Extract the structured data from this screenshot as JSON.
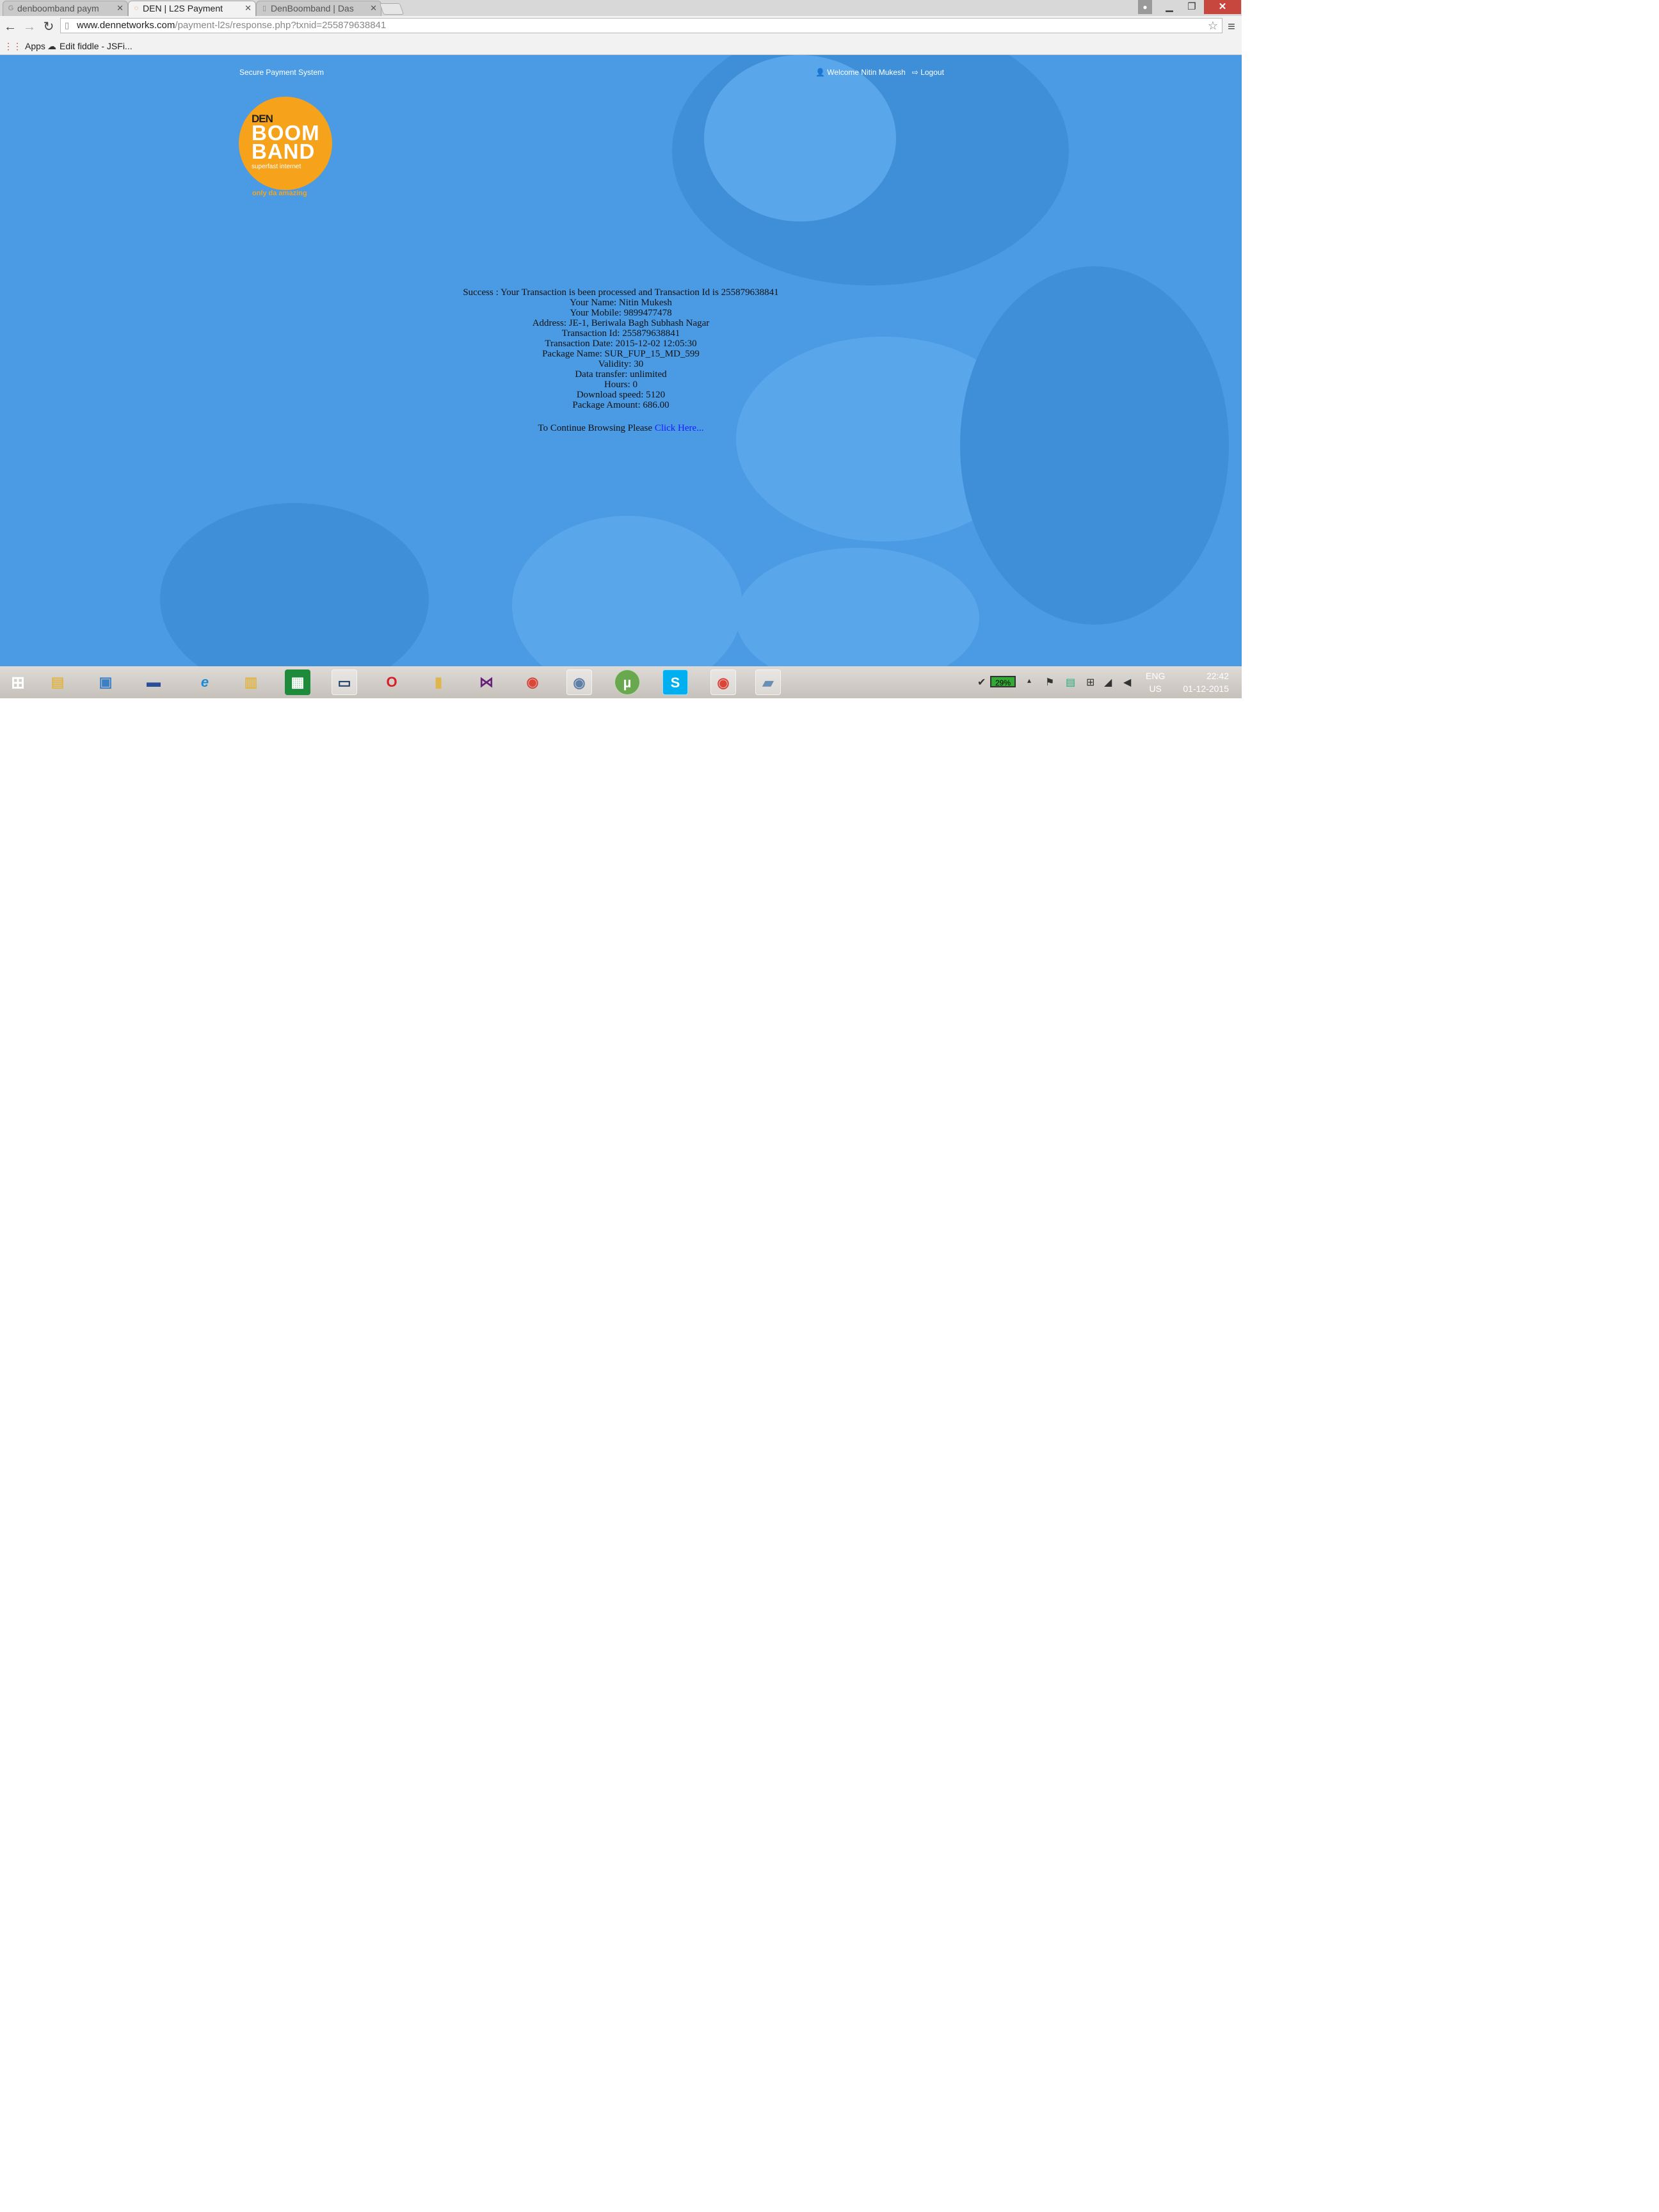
{
  "browser": {
    "tabs": [
      {
        "label": "denboomband paym",
        "favicon": "google-icon"
      },
      {
        "label": "DEN | L2S Payment",
        "favicon": "loading-icon",
        "active": true
      },
      {
        "label": "DenBoomband | Das",
        "favicon": "page-icon"
      }
    ],
    "url_host": "www.dennetworks.com",
    "url_path": "/payment-l2s/response.php?txnid=255879638841",
    "bookmarks": [
      {
        "label": "Apps",
        "icon": "apps-grid-icon"
      },
      {
        "label": "Edit fiddle - JSFi...",
        "icon": "jsfiddle-icon"
      }
    ]
  },
  "header": {
    "secure_label": "Secure Payment System",
    "welcome": "Welcome Nitin Mukesh",
    "logout": "Logout"
  },
  "logo": {
    "den": "DEN",
    "boom": "BOOM",
    "band": "BAND",
    "subtitle": "superfast internet",
    "tagline": "only da amazing"
  },
  "message": {
    "lines": [
      "Success : Your Transaction is been processed and Transaction Id is 255879638841",
      "Your Name: Nitin Mukesh",
      "Your Mobile: 9899477478",
      "Address: JE-1, Beriwala Bagh Subhash Nagar",
      "Transaction Id: 255879638841",
      "Transaction Date: 2015-12-02 12:05:30",
      "Package Name: SUR_FUP_15_MD_599",
      "Validity: 30",
      "Data transfer: unlimited",
      "Hours: 0",
      "Download speed: 5120",
      "Package Amount: 686.00"
    ],
    "continue_prefix": "To Continue Browsing Please ",
    "continue_link": "Click Here..."
  },
  "taskbar": {
    "apps": [
      "start-icon",
      "file-explorer-icon",
      "remote-desktop-icon",
      "computer-icon",
      "internet-explorer-icon",
      "libraries-icon",
      "store-icon",
      "monitor-icon",
      "opera-icon",
      "notes-icon",
      "visual-studio-icon",
      "chrome-icon",
      "chrome-canary-icon",
      "utorrent-icon",
      "skype-icon",
      "chrome-icon",
      "calculator-icon"
    ],
    "battery": "29%",
    "lang_top": "ENG",
    "lang_bottom": "US",
    "time": "22:42",
    "date": "01-12-2015"
  }
}
